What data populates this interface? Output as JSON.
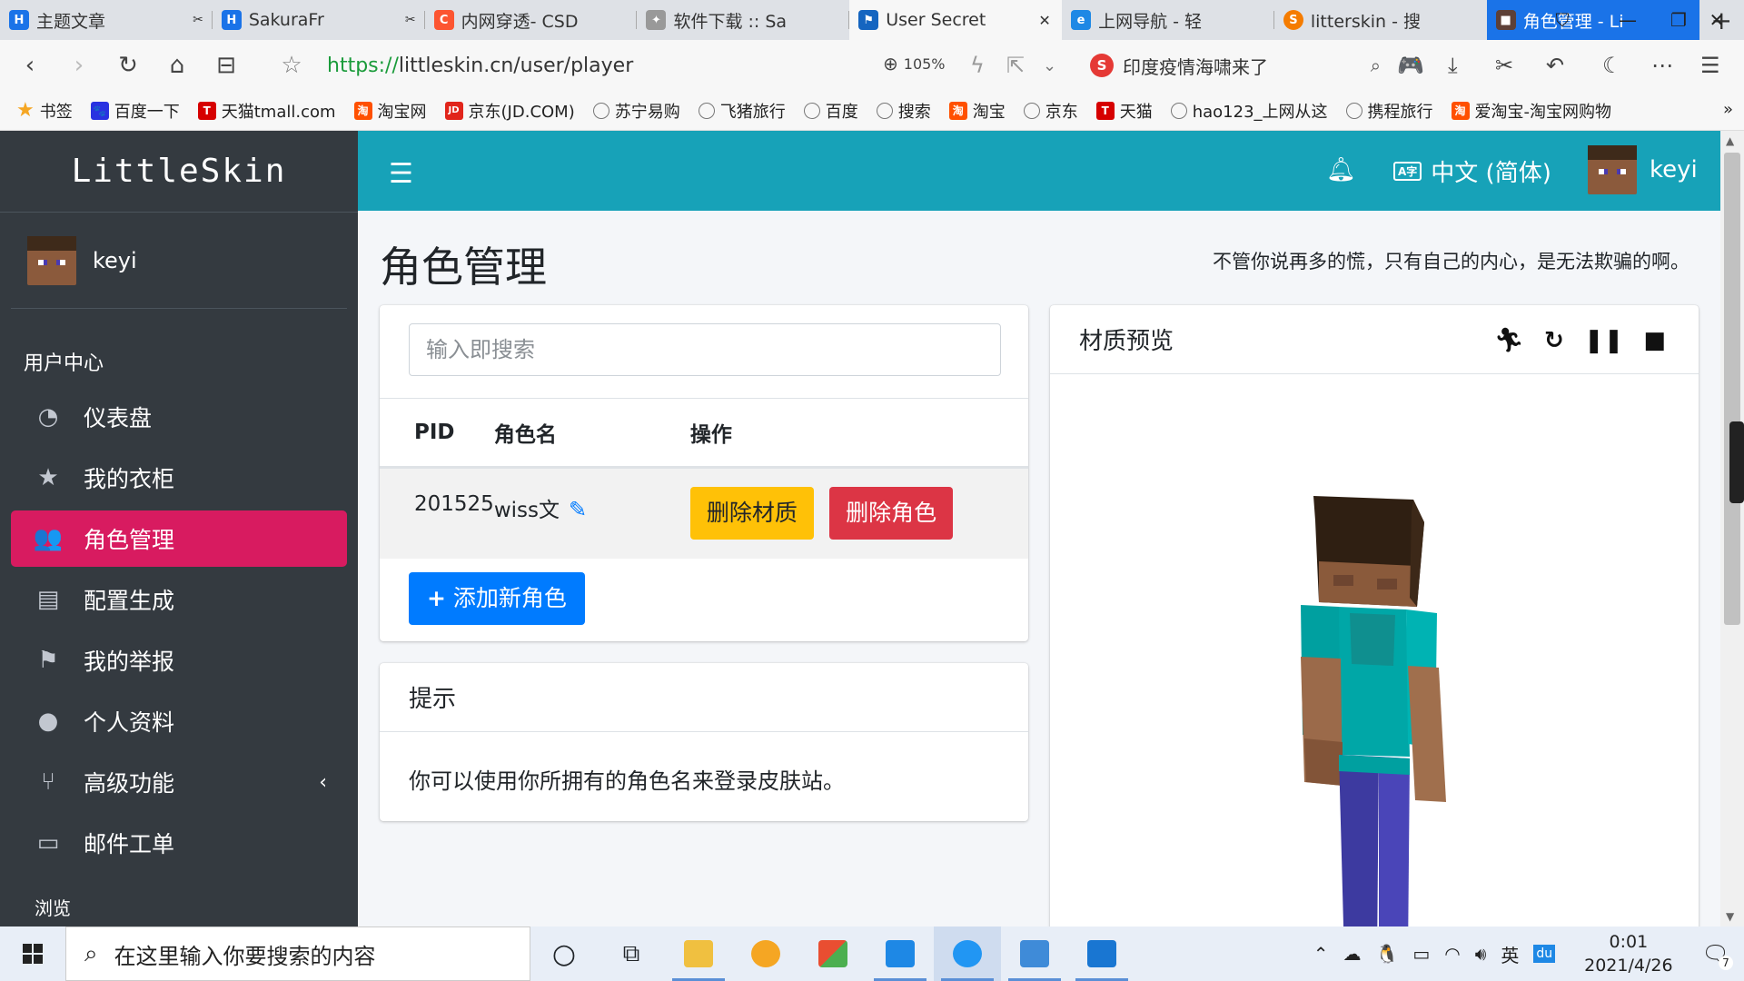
{
  "browser": {
    "tabs": [
      {
        "label": "主题文章",
        "icon": "H",
        "icon_color": "#1a73e8",
        "pinned_mark": "✂"
      },
      {
        "label": "SakuraFr",
        "icon": "H",
        "icon_color": "#1a73e8",
        "pinned_mark": "✂"
      },
      {
        "label": "内网穿透- CSD",
        "icon": "C",
        "icon_color": "#fc5531"
      },
      {
        "label": "软件下载 :: Sa",
        "icon": "✦",
        "icon_color": "#888888"
      },
      {
        "label": "User Secret",
        "icon": "⚑",
        "icon_color": "#1565c0",
        "active": true
      },
      {
        "label": "上网导航 - 轻",
        "icon": "e",
        "icon_color": "#1e88e5"
      },
      {
        "label": "litterskin - 搜",
        "icon": "S",
        "icon_color": "#f57c00"
      },
      {
        "label": "角色管理 - Li",
        "icon": "■",
        "icon_color": "#5d4037",
        "highlight": true
      }
    ],
    "url_scheme": "https://",
    "url_rest": "littleskin.cn/user/player",
    "zoom": "105%",
    "news_text": "印度疫情海啸来了",
    "bookmarks_label": "书签",
    "bookmarks": [
      {
        "label": "百度一下",
        "icon": "🐾",
        "color": "#2932e1"
      },
      {
        "label": "天猫tmall.com",
        "icon": "T",
        "color": "#d60000"
      },
      {
        "label": "淘宝网",
        "icon": "淘",
        "color": "#ff5000"
      },
      {
        "label": "京东(JD.COM)",
        "icon": "JD",
        "color": "#e1251b"
      },
      {
        "label": "苏宁易购",
        "icon": "globe"
      },
      {
        "label": "飞猪旅行",
        "icon": "globe"
      },
      {
        "label": "百度",
        "icon": "globe"
      },
      {
        "label": "搜索",
        "icon": "globe"
      },
      {
        "label": "淘宝",
        "icon": "淘",
        "color": "#ff5000"
      },
      {
        "label": "京东",
        "icon": "globe"
      },
      {
        "label": "天猫",
        "icon": "T",
        "color": "#d60000"
      },
      {
        "label": "hao123_上网从这",
        "icon": "globe"
      },
      {
        "label": "携程旅行",
        "icon": "globe"
      },
      {
        "label": "爱淘宝-淘宝网购物",
        "icon": "淘",
        "color": "#ff5000"
      }
    ]
  },
  "sidebar": {
    "brand": "LittleSkin",
    "username": "keyi",
    "section_header": "用户中心",
    "items": [
      {
        "label": "仪表盘",
        "icon": "◔"
      },
      {
        "label": "我的衣柜",
        "icon": "★"
      },
      {
        "label": "角色管理",
        "icon": "👥",
        "active": true
      },
      {
        "label": "配置生成",
        "icon": "▤"
      },
      {
        "label": "我的举报",
        "icon": "⚑"
      },
      {
        "label": "个人资料",
        "icon": "●"
      },
      {
        "label": "高级功能",
        "icon": "⑂",
        "has_submenu": true
      },
      {
        "label": "邮件工单",
        "icon": "▭"
      }
    ],
    "next_header": "浏览"
  },
  "header": {
    "language": "中文 (简体)",
    "lang_icon": "A字",
    "username": "keyi"
  },
  "main": {
    "title": "角色管理",
    "quote": "不管你说再多的慌，只有自己的内心，是无法欺骗的啊。",
    "search_placeholder": "输入即搜索",
    "table": {
      "headers": [
        "PID",
        "角色名",
        "操作"
      ],
      "rows": [
        {
          "pid": "201525",
          "name": "wiss文",
          "delete_texture": "删除材质",
          "delete_player": "删除角色"
        }
      ]
    },
    "add_button": "添加新角色",
    "tip_title": "提示",
    "tip_text": "你可以使用你所拥有的角色名来登录皮肤站。",
    "preview_title": "材质预览"
  },
  "taskbar": {
    "search_placeholder": "在这里输入你要搜索的内容",
    "time": "0:01",
    "date": "2021/4/26",
    "ime": "英",
    "notif_count": "7"
  },
  "colors": {
    "accent_teal": "#17a2b8",
    "sidebar_bg": "#343a40",
    "active_pink": "#d81b60",
    "warning": "#ffc107",
    "danger": "#dc3545",
    "primary": "#007bff"
  }
}
